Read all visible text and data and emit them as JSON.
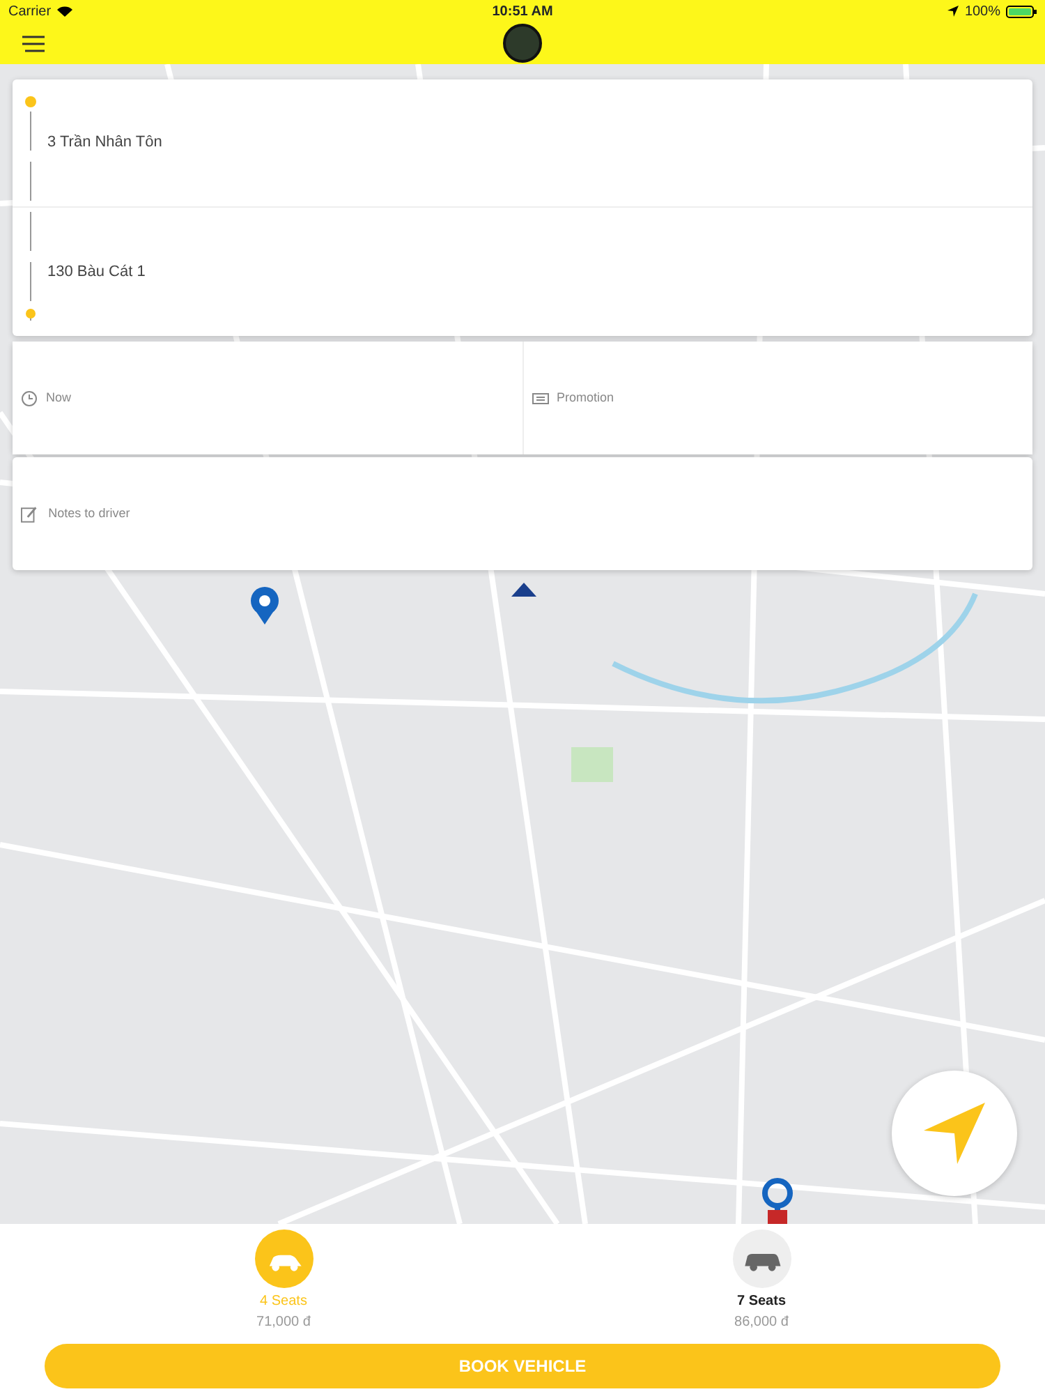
{
  "status_bar": {
    "carrier": "Carrier",
    "time": "10:51 AM",
    "battery": "100%"
  },
  "trip": {
    "pickup": "3 Trần Nhân Tôn",
    "dropoff": "130 Bàu Cát 1"
  },
  "options": [
    {
      "kind": "time",
      "label": "Now"
    },
    {
      "kind": "promotion",
      "label": "Promotion"
    }
  ],
  "notes": {
    "placeholder": "Notes to driver"
  },
  "vehicles": [
    {
      "kind": "car",
      "name": "4 Seats",
      "price": "71,000 đ",
      "selected": true
    },
    {
      "kind": "van",
      "name": "7 Seats",
      "price": "86,000 đ",
      "selected": false
    }
  ],
  "book_button": "BOOK VEHICLE"
}
